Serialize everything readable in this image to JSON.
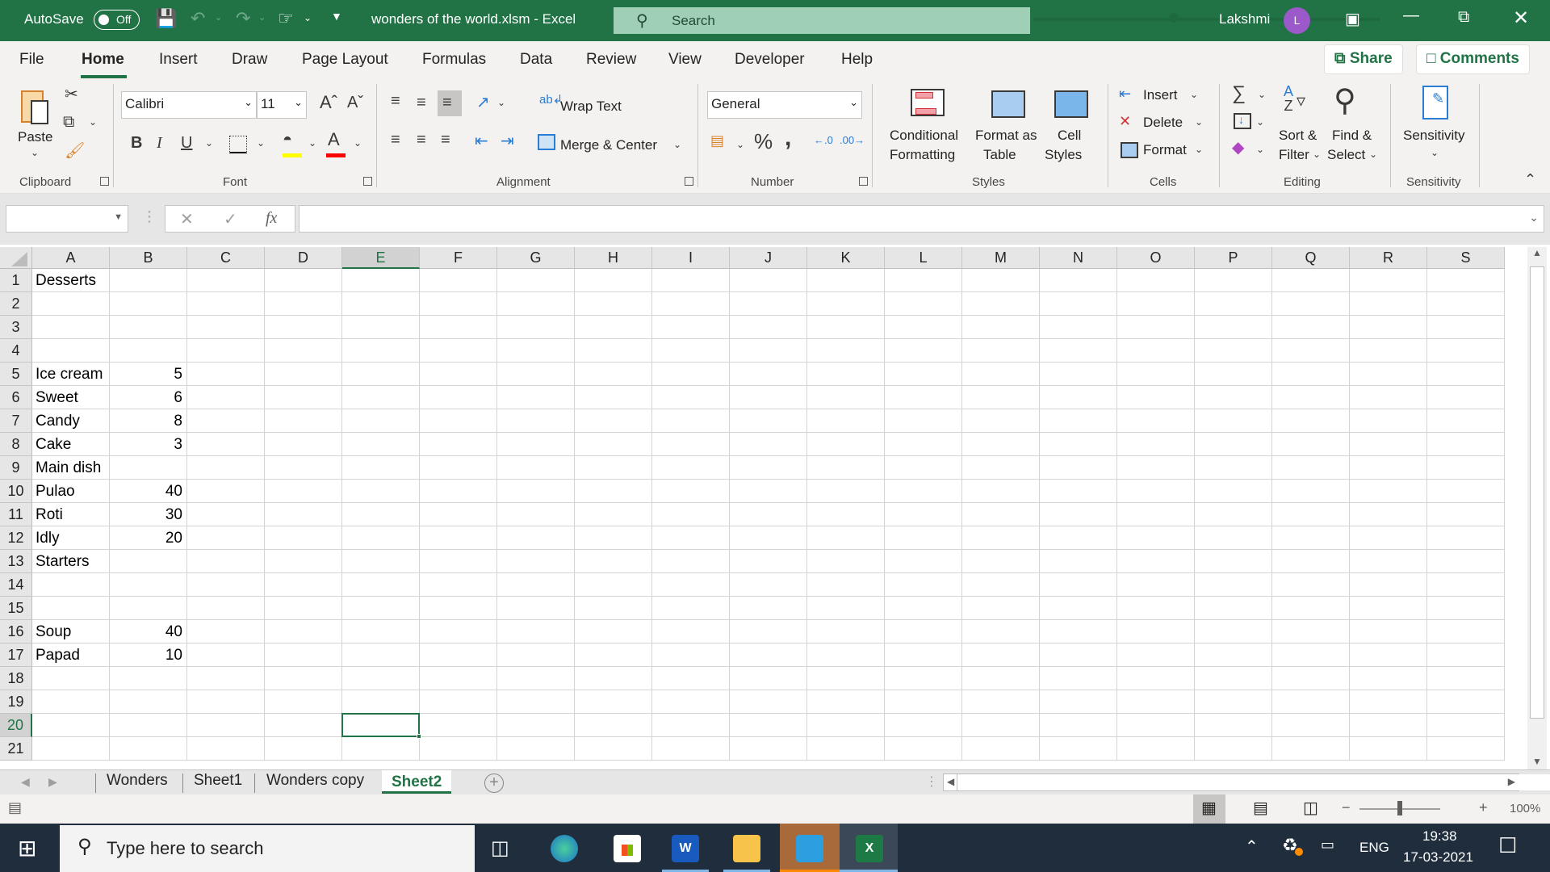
{
  "titlebar": {
    "autosave_label": "AutoSave",
    "autosave_state": "Off",
    "file_title": "wonders of the world.xlsm  -  Excel",
    "search_placeholder": "Search",
    "user_name": "Lakshmi",
    "user_initial": "L",
    "brand_color": "#217346"
  },
  "menu": {
    "tabs": [
      "File",
      "Home",
      "Insert",
      "Draw",
      "Page Layout",
      "Formulas",
      "Data",
      "Review",
      "View",
      "Developer",
      "Help"
    ],
    "active_tab": "Home",
    "share_label": "Share",
    "comments_label": "Comments"
  },
  "ribbon": {
    "clipboard": {
      "paste_label": "Paste",
      "group_label": "Clipboard"
    },
    "font": {
      "font_name": "Calibri",
      "font_size": "11",
      "bold": "B",
      "italic": "I",
      "underline": "U",
      "group_label": "Font",
      "highlight_color": "#ffff00",
      "font_color": "#ff0000"
    },
    "alignment": {
      "wrap_text_label": "Wrap Text",
      "merge_center_label": "Merge & Center",
      "group_label": "Alignment"
    },
    "number": {
      "format": "General",
      "percent": "%",
      "comma": ",",
      "group_label": "Number"
    },
    "styles": {
      "conditional_formatting_label_1": "Conditional",
      "conditional_formatting_label_2": "Formatting",
      "format_table_label_1": "Format as",
      "format_table_label_2": "Table",
      "cell_styles_label_1": "Cell",
      "cell_styles_label_2": "Styles",
      "group_label": "Styles"
    },
    "cells": {
      "insert_label": "Insert",
      "delete_label": "Delete",
      "format_label": "Format",
      "group_label": "Cells"
    },
    "editing": {
      "sort_label_1": "Sort &",
      "sort_label_2": "Filter",
      "find_label_1": "Find &",
      "find_label_2": "Select",
      "group_label": "Editing"
    },
    "sensitivity": {
      "label": "Sensitivity",
      "group_label": "Sensitivity"
    }
  },
  "formula_bar": {
    "name_box": "",
    "formula": "",
    "fx_label": "fx"
  },
  "sheet": {
    "columns": [
      "A",
      "B",
      "C",
      "D",
      "E",
      "F",
      "G",
      "H",
      "I",
      "J",
      "K",
      "L",
      "M",
      "N",
      "O",
      "P",
      "Q",
      "R",
      "S"
    ],
    "selected_column": "E",
    "selected_row": 20,
    "selected_cell": "E20",
    "row_numbers": [
      1,
      2,
      3,
      4,
      5,
      6,
      7,
      8,
      9,
      10,
      11,
      12,
      13,
      14,
      15,
      16,
      17,
      18,
      19,
      20,
      21
    ],
    "rows": [
      {
        "row": 1,
        "A": "Desserts",
        "B": ""
      },
      {
        "row": 2,
        "A": "",
        "B": ""
      },
      {
        "row": 3,
        "A": "",
        "B": ""
      },
      {
        "row": 4,
        "A": "",
        "B": ""
      },
      {
        "row": 5,
        "A": "Ice cream",
        "B": "5"
      },
      {
        "row": 6,
        "A": "Sweet",
        "B": "6"
      },
      {
        "row": 7,
        "A": "Candy",
        "B": "8"
      },
      {
        "row": 8,
        "A": "Cake",
        "B": "3"
      },
      {
        "row": 9,
        "A": "Main dish",
        "B": ""
      },
      {
        "row": 10,
        "A": "Pulao",
        "B": "40"
      },
      {
        "row": 11,
        "A": "Roti",
        "B": "30"
      },
      {
        "row": 12,
        "A": "Idly",
        "B": "20"
      },
      {
        "row": 13,
        "A": "Starters",
        "B": ""
      },
      {
        "row": 14,
        "A": "",
        "B": ""
      },
      {
        "row": 15,
        "A": "",
        "B": ""
      },
      {
        "row": 16,
        "A": "Soup",
        "B": "40"
      },
      {
        "row": 17,
        "A": "Papad",
        "B": "10"
      },
      {
        "row": 18,
        "A": "",
        "B": ""
      },
      {
        "row": 19,
        "A": "",
        "B": ""
      },
      {
        "row": 20,
        "A": "",
        "B": ""
      },
      {
        "row": 21,
        "A": "",
        "B": ""
      }
    ]
  },
  "sheet_tabs": {
    "tabs": [
      "Wonders",
      "Sheet1",
      "Wonders copy",
      "Sheet2"
    ],
    "active": "Sheet2",
    "add_label": "+"
  },
  "statusbar": {
    "zoom_minus": "−",
    "zoom_plus": "+",
    "zoom_level": "100%",
    "zoom_percent": 100
  },
  "taskbar": {
    "search_placeholder": "Type here to search",
    "language": "ENG",
    "time": "19:38",
    "date": "17-03-2021"
  }
}
